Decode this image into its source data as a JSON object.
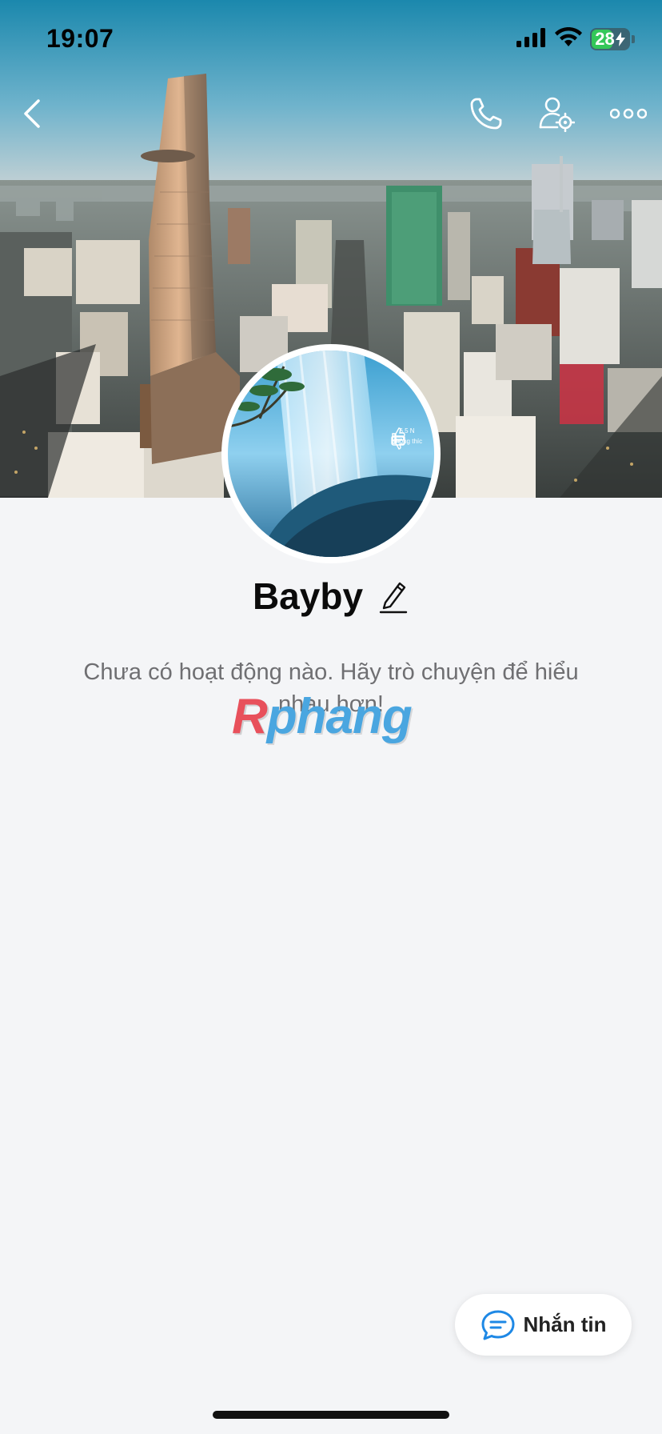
{
  "status_bar": {
    "time": "19:07",
    "battery_level": "28",
    "icons": [
      "cellular-signal-icon",
      "wifi-icon",
      "battery-charging-icon"
    ]
  },
  "nav": {
    "icons": [
      "back-chevron-icon",
      "phone-icon",
      "user-settings-icon",
      "more-icon"
    ]
  },
  "avatar_overlay": {
    "likes": "6,5 N",
    "dislike_label": "Không thíc"
  },
  "profile": {
    "name": "Bayby"
  },
  "empty_state": {
    "message": "Chưa có hoạt động nào. Hãy trò chuyện để hiểu nhau hơn!"
  },
  "watermark": {
    "first_letter": "R",
    "rest": "phang"
  },
  "message_button": {
    "label": "Nhắn tin",
    "icon": "chat-bubble-icon"
  },
  "colors": {
    "background": "#f4f5f7",
    "accent_blue": "#1e88e5",
    "battery_green": "#34c759"
  }
}
